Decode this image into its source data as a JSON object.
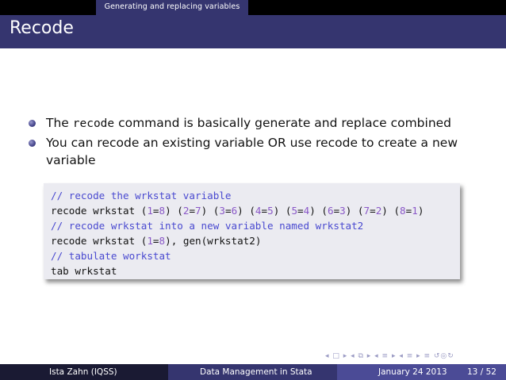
{
  "header": {
    "section_title": "Generating and replacing variables"
  },
  "frame": {
    "title": "Recode"
  },
  "bullets": [
    {
      "pre": "The ",
      "code": "recode",
      "post": " command is basically generate and replace combined"
    },
    {
      "line1": "You can recode an existing variable OR use recode to create a new",
      "line2": "variable"
    }
  ],
  "code": {
    "lines": [
      "// recode the wrkstat variable",
      "recode wrkstat (1=8) (2=7) (3=6) (4=5) (5=4) (6=3) (7=2) (8=1)",
      "// recode wrkstat into a new variable named wrkstat2",
      "recode wrkstat (1=8), gen(wrkstat2)",
      "// tabulate workstat",
      "tab wrkstat"
    ]
  },
  "nav": {
    "symbols": "◂ □ ▸ ◂ ⧉ ▸ ◂ ≡ ▸ ◂ ≡ ▸ ≡ ↺◎↻"
  },
  "footer": {
    "author": "Ista Zahn  (IQSS)",
    "title": "Data Management in Stata",
    "date": "January 24 2013",
    "page": "13 / 52"
  },
  "colors": {
    "beamer_blue": "#35356f",
    "comment": "#4a4ad0",
    "number": "#8a58c8",
    "code_bg": "#ebebf1"
  }
}
